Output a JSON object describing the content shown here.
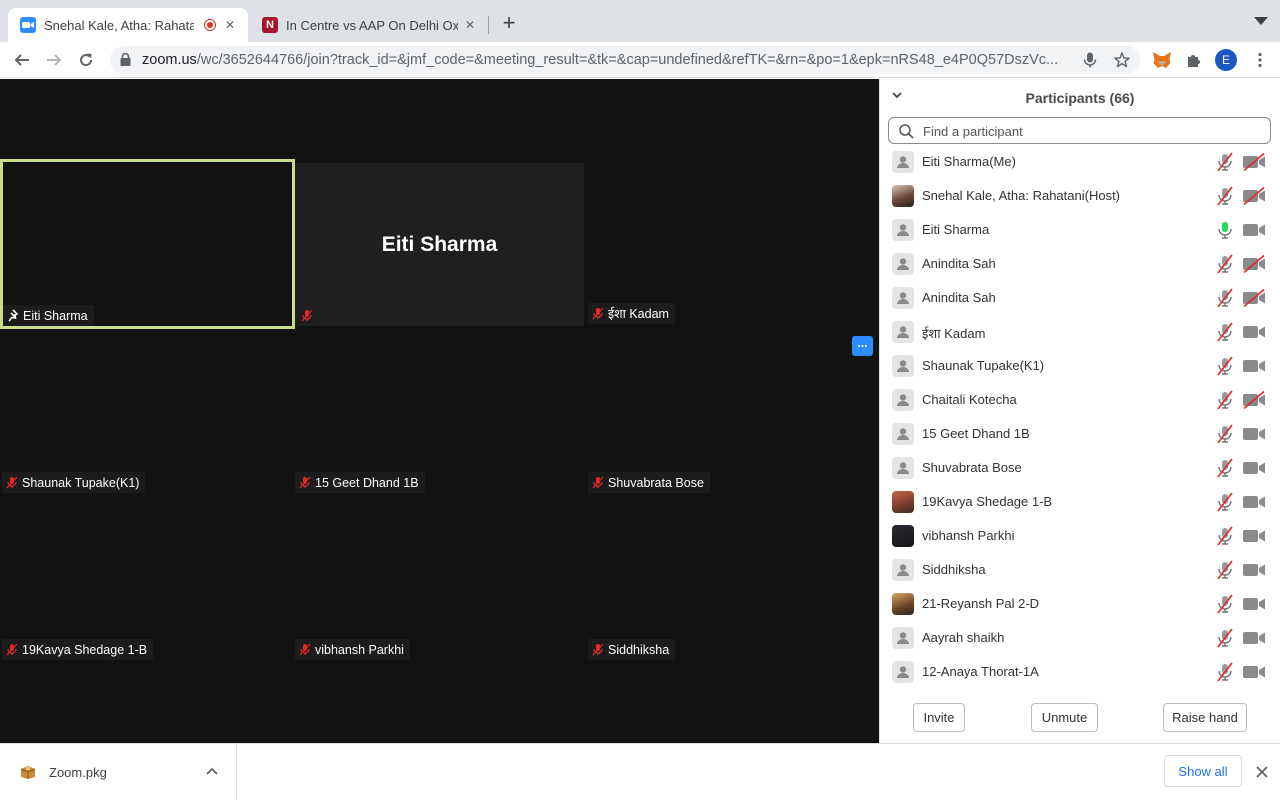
{
  "browser": {
    "tabs": [
      {
        "title": "Snehal Kale, Atha: Rahatani",
        "favicon": "zoom-icon",
        "recording": true,
        "active": true
      },
      {
        "title": "In Centre vs AAP On Delhi Oxygen",
        "favicon": "ndtv-icon",
        "active": false
      }
    ],
    "url_host": "zoom.us",
    "url_path": "/wc/3652644766/join?track_id=&jmf_code=&meeting_result=&tk=&cap=undefined&refTK=&rn=&po=1&epk=nRS48_e4P0Q57DszVc...",
    "profile_initial": "E",
    "colors": {
      "zoom_blue": "#2d8cff",
      "record_red": "#d93025",
      "ndtv_red": "#a4162a",
      "profile": "#1a56c4"
    }
  },
  "meeting": {
    "tiles": [
      {
        "name": "Eiti Sharma",
        "pinned": true,
        "active": true
      },
      {
        "name": "",
        "center_name": "Eiti Sharma",
        "muted": true
      },
      {
        "name": "ईशा Kadam",
        "muted": true
      },
      {
        "name": "Shaunak Tupake(K1)",
        "muted": true
      },
      {
        "name": "15 Geet Dhand 1B",
        "muted": true
      },
      {
        "name": "Shuvabrata Bose",
        "muted": true
      },
      {
        "name": "19Kavya Shedage 1-B",
        "muted": true
      },
      {
        "name": "vibhansh Parkhi",
        "muted": true
      },
      {
        "name": "Siddhiksha",
        "muted": true
      }
    ],
    "more_label": "..."
  },
  "participants": {
    "title": "Participants (66)",
    "search_placeholder": "Find a participant",
    "list": [
      {
        "name": "Eiti Sharma(Me)",
        "avatar": "default",
        "mic": "muted",
        "cam": "off"
      },
      {
        "name": "Snehal Kale, Atha: Rahatani(Host)",
        "avatar": "photo-woman",
        "mic": "muted",
        "cam": "off"
      },
      {
        "name": "Eiti Sharma",
        "avatar": "default",
        "mic": "on",
        "cam": "on"
      },
      {
        "name": "Anindita Sah",
        "avatar": "default",
        "mic": "muted",
        "cam": "off"
      },
      {
        "name": "Anindita Sah",
        "avatar": "default",
        "mic": "muted",
        "cam": "off"
      },
      {
        "name": "ईशा Kadam",
        "avatar": "default",
        "mic": "muted",
        "cam": "on"
      },
      {
        "name": "Shaunak Tupake(K1)",
        "avatar": "default",
        "mic": "muted",
        "cam": "on"
      },
      {
        "name": "Chaitali Kotecha",
        "avatar": "default",
        "mic": "muted",
        "cam": "off"
      },
      {
        "name": "15 Geet Dhand 1B",
        "avatar": "default",
        "mic": "muted",
        "cam": "on"
      },
      {
        "name": "Shuvabrata Bose",
        "avatar": "default",
        "mic": "muted",
        "cam": "on"
      },
      {
        "name": "19Kavya Shedage 1-B",
        "avatar": "photo-girl",
        "mic": "muted",
        "cam": "on"
      },
      {
        "name": "vibhansh Parkhi",
        "avatar": "photo-dark",
        "mic": "muted",
        "cam": "on"
      },
      {
        "name": "Siddhiksha",
        "avatar": "default",
        "mic": "muted",
        "cam": "on"
      },
      {
        "name": "21-Reyansh Pal 2-D",
        "avatar": "photo-boy",
        "mic": "muted",
        "cam": "on"
      },
      {
        "name": "Aayrah shaikh",
        "avatar": "default",
        "mic": "muted",
        "cam": "on"
      },
      {
        "name": "12-Anaya Thorat-1A",
        "avatar": "default",
        "mic": "muted",
        "cam": "on"
      }
    ],
    "buttons": {
      "invite": "Invite",
      "unmute": "Unmute",
      "raise_hand": "Raise hand"
    }
  },
  "downloads": {
    "file_name": "Zoom.pkg",
    "show_all": "Show all"
  }
}
